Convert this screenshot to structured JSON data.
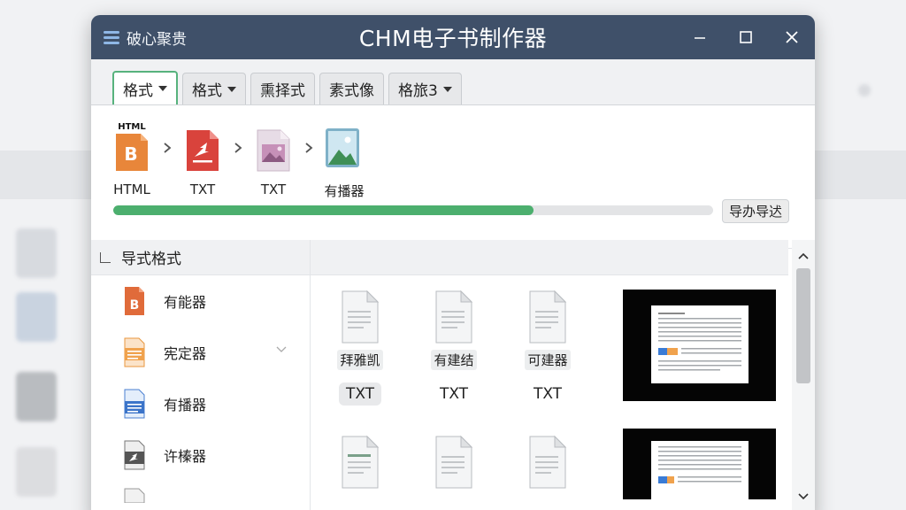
{
  "window": {
    "app_menu_label": "破心聚贵",
    "title": "CHM电子书制作器"
  },
  "tabs": [
    {
      "label": "格式",
      "has_dropdown": true,
      "active": true
    },
    {
      "label": "格式",
      "has_dropdown": true,
      "active": false
    },
    {
      "label": "熏择式",
      "has_dropdown": false,
      "active": false
    },
    {
      "label": "素式像",
      "has_dropdown": false,
      "active": false
    },
    {
      "label": "格旅3",
      "has_dropdown": true,
      "active": false
    }
  ],
  "pipeline": {
    "steps": [
      {
        "label": "HTML",
        "icon": "html-file-icon",
        "badge": "HTML",
        "glyph": "B"
      },
      {
        "label": "TXT",
        "icon": "txt-file-icon"
      },
      {
        "label": "TXT",
        "icon": "image-file-icon"
      },
      {
        "label": "有播器",
        "icon": "landscape-image-icon"
      }
    ],
    "progress_percent": 70,
    "action_label": "导办导迖"
  },
  "sidebar": {
    "header": "导式格式",
    "items": [
      {
        "label": "有能器",
        "icon": "b-file-icon"
      },
      {
        "label": "宪定器",
        "icon": "orange-doc-icon",
        "has_chevron": true
      },
      {
        "label": "有播器",
        "icon": "blue-doc-icon"
      },
      {
        "label": "许榛器",
        "icon": "dark-doc-icon"
      }
    ]
  },
  "content": {
    "row1": [
      {
        "name": "拜雅凯",
        "ext": "TXT",
        "selected": true
      },
      {
        "name": "有建结",
        "ext": "TXT",
        "selected": false
      },
      {
        "name": "可建器",
        "ext": "TXT",
        "selected": false
      }
    ]
  },
  "colors": {
    "titlebar": "#3f5069",
    "accent_green": "#4caf6e",
    "active_tab_border": "#57b27d"
  }
}
